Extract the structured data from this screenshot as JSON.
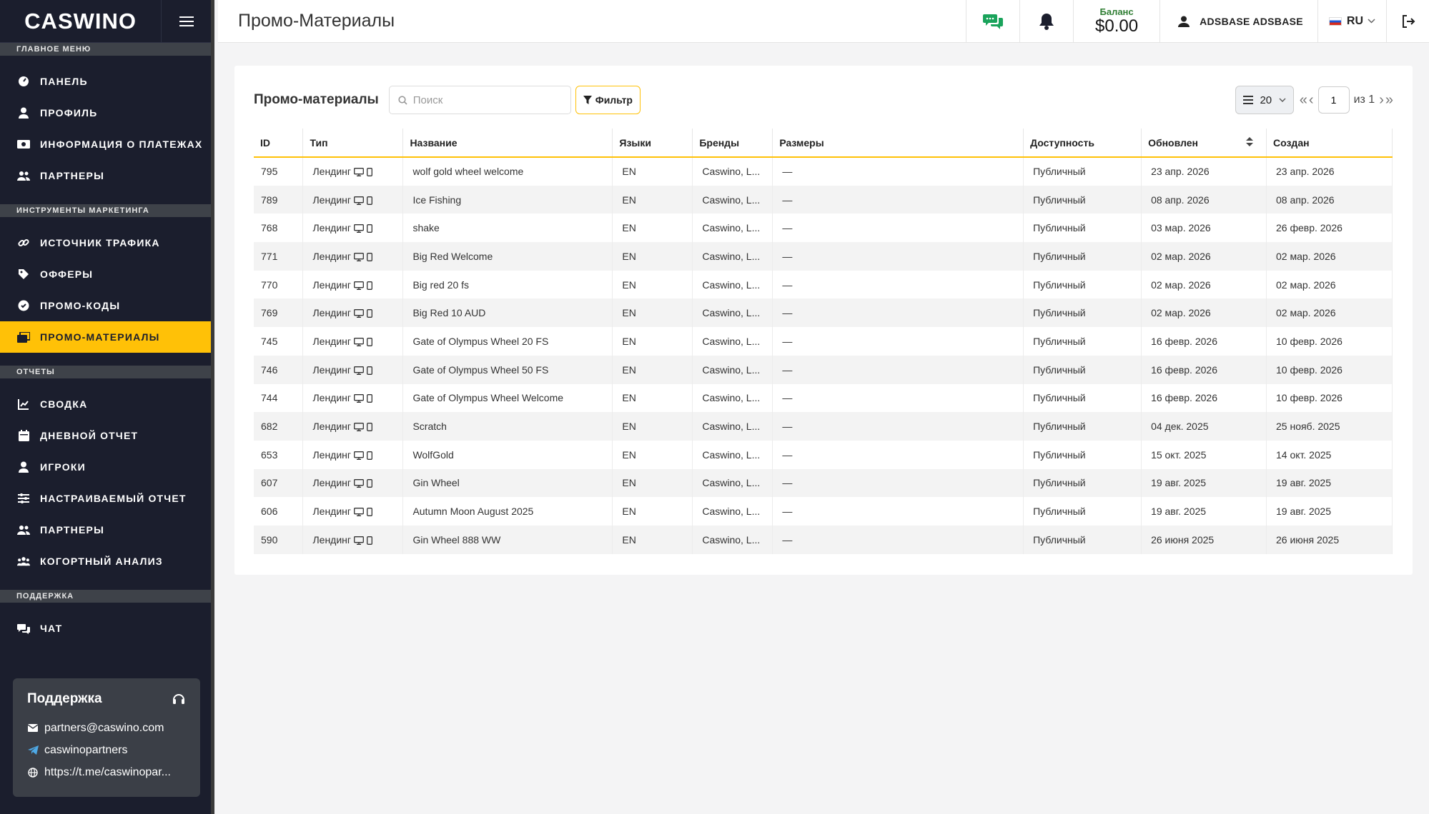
{
  "brand": {
    "logo_text": "CASWINO",
    "accent": "#ffc107",
    "sidebar_bg": "#1b1e2d"
  },
  "sidebar": {
    "sections": [
      {
        "title": "ГЛАВНОЕ МЕНЮ",
        "items": [
          {
            "label": "ПАНЕЛЬ",
            "icon": "dashboard-icon"
          },
          {
            "label": "ПРОФИЛЬ",
            "icon": "user-icon"
          },
          {
            "label": "ИНФОРМАЦИЯ О ПЛАТЕЖАХ",
            "icon": "money-icon"
          },
          {
            "label": "ПАРТНЕРЫ",
            "icon": "users-icon"
          }
        ]
      },
      {
        "title": "ИНСТРУМЕНТЫ МАРКЕТИНГА",
        "items": [
          {
            "label": "ИСТОЧНИК ТРАФИКА",
            "icon": "link-icon"
          },
          {
            "label": "ОФФЕРЫ",
            "icon": "tags-icon"
          },
          {
            "label": "ПРОМО-КОДЫ",
            "icon": "badge-icon"
          },
          {
            "label": "ПРОМО-МАТЕРИАЛЫ",
            "icon": "images-icon",
            "active": true
          }
        ]
      },
      {
        "title": "ОТЧЕТЫ",
        "items": [
          {
            "label": "СВОДКА",
            "icon": "chart-icon"
          },
          {
            "label": "ДНЕВНОЙ ОТЧЕТ",
            "icon": "calendar-icon"
          },
          {
            "label": "ИГРОКИ",
            "icon": "user-icon"
          },
          {
            "label": "НАСТРАИВАЕМЫЙ ОТЧЕТ",
            "icon": "sliders-icon"
          },
          {
            "label": "ПАРТНЕРЫ",
            "icon": "users-icon"
          },
          {
            "label": "КОГОРТНЫЙ АНАЛИЗ",
            "icon": "group-icon"
          }
        ]
      },
      {
        "title": "ПОДДЕРЖКА",
        "items": [
          {
            "label": "ЧАТ",
            "icon": "chat-icon"
          }
        ]
      }
    ],
    "support_card": {
      "title": "Поддержка",
      "email": "partners@caswino.com",
      "telegram": "caswinopartners",
      "url": "https://t.me/caswinopar..."
    }
  },
  "topbar": {
    "title": "Промо-Материалы",
    "balance_label": "Баланс",
    "balance_value": "$0.00",
    "user_name": "ADSBASE ADSBASE",
    "language": "RU"
  },
  "promo": {
    "title": "Промо-материалы",
    "search_placeholder": "Поиск",
    "filter_label": "Фильтр",
    "per_page": "20",
    "page": "1",
    "of_label": "из 1",
    "columns": [
      "ID",
      "Тип",
      "Название",
      "Языки",
      "Бренды",
      "Размеры",
      "Доступность",
      "Обновлен",
      "Создан"
    ],
    "rows": [
      {
        "id": "795",
        "type": "Лендинг",
        "name": "wolf gold wheel welcome",
        "lang": "EN",
        "brand": "Caswino, L...",
        "size": "—",
        "access": "Публичный",
        "updated": "23 апр. 2026",
        "created": "23 апр. 2026"
      },
      {
        "id": "789",
        "type": "Лендинг",
        "name": "Ice Fishing",
        "lang": "EN",
        "brand": "Caswino, L...",
        "size": "—",
        "access": "Публичный",
        "updated": "08 апр. 2026",
        "created": "08 апр. 2026"
      },
      {
        "id": "768",
        "type": "Лендинг",
        "name": "shake",
        "lang": "EN",
        "brand": "Caswino, L...",
        "size": "—",
        "access": "Публичный",
        "updated": "03 мар. 2026",
        "created": "26 февр. 2026"
      },
      {
        "id": "771",
        "type": "Лендинг",
        "name": "Big Red Welcome",
        "lang": "EN",
        "brand": "Caswino, L...",
        "size": "—",
        "access": "Публичный",
        "updated": "02 мар. 2026",
        "created": "02 мар. 2026"
      },
      {
        "id": "770",
        "type": "Лендинг",
        "name": "Big red 20 fs",
        "lang": "EN",
        "brand": "Caswino, L...",
        "size": "—",
        "access": "Публичный",
        "updated": "02 мар. 2026",
        "created": "02 мар. 2026"
      },
      {
        "id": "769",
        "type": "Лендинг",
        "name": "Big Red 10 AUD",
        "lang": "EN",
        "brand": "Caswino, L...",
        "size": "—",
        "access": "Публичный",
        "updated": "02 мар. 2026",
        "created": "02 мар. 2026"
      },
      {
        "id": "745",
        "type": "Лендинг",
        "name": "Gate of Olympus Wheel 20 FS",
        "lang": "EN",
        "brand": "Caswino, L...",
        "size": "—",
        "access": "Публичный",
        "updated": "16 февр. 2026",
        "created": "10 февр. 2026"
      },
      {
        "id": "746",
        "type": "Лендинг",
        "name": "Gate of Olympus Wheel 50 FS",
        "lang": "EN",
        "brand": "Caswino, L...",
        "size": "—",
        "access": "Публичный",
        "updated": "16 февр. 2026",
        "created": "10 февр. 2026"
      },
      {
        "id": "744",
        "type": "Лендинг",
        "name": "Gate of Olympus Wheel Welcome",
        "lang": "EN",
        "brand": "Caswino, L...",
        "size": "—",
        "access": "Публичный",
        "updated": "16 февр. 2026",
        "created": "10 февр. 2026"
      },
      {
        "id": "682",
        "type": "Лендинг",
        "name": "Scratch",
        "lang": "EN",
        "brand": "Caswino, L...",
        "size": "—",
        "access": "Публичный",
        "updated": "04 дек. 2025",
        "created": "25 нояб. 2025"
      },
      {
        "id": "653",
        "type": "Лендинг",
        "name": "WolfGold",
        "lang": "EN",
        "brand": "Caswino, L...",
        "size": "—",
        "access": "Публичный",
        "updated": "15 окт. 2025",
        "created": "14 окт. 2025"
      },
      {
        "id": "607",
        "type": "Лендинг",
        "name": "Gin Wheel",
        "lang": "EN",
        "brand": "Caswino, L...",
        "size": "—",
        "access": "Публичный",
        "updated": "19 авг. 2025",
        "created": "19 авг. 2025"
      },
      {
        "id": "606",
        "type": "Лендинг",
        "name": "Autumn Moon August 2025",
        "lang": "EN",
        "brand": "Caswino, L...",
        "size": "—",
        "access": "Публичный",
        "updated": "19 авг. 2025",
        "created": "19 авг. 2025"
      },
      {
        "id": "590",
        "type": "Лендинг",
        "name": "Gin Wheel 888 WW",
        "lang": "EN",
        "brand": "Caswino, L...",
        "size": "—",
        "access": "Публичный",
        "updated": "26 июня 2025",
        "created": "26 июня 2025"
      }
    ]
  }
}
